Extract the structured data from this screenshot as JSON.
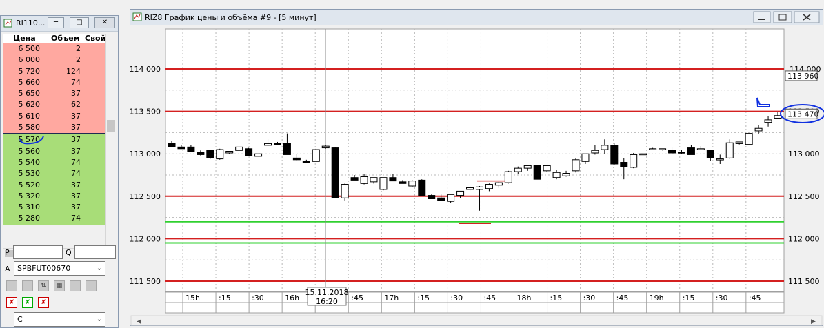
{
  "orderbook": {
    "title": "RI110...",
    "headers": {
      "price": "Цена",
      "volume": "Объем",
      "own": "Свой"
    },
    "asks": [
      {
        "price": "6 500",
        "volume": "2"
      },
      {
        "price": "6 000",
        "volume": "2"
      },
      {
        "price": "5 720",
        "volume": "124"
      },
      {
        "price": "5 660",
        "volume": "74"
      },
      {
        "price": "5 650",
        "volume": "37"
      },
      {
        "price": "5 620",
        "volume": "62"
      },
      {
        "price": "5 610",
        "volume": "37"
      },
      {
        "price": "5 580",
        "volume": "37"
      }
    ],
    "bids": [
      {
        "price": "5 570",
        "volume": "37"
      },
      {
        "price": "5 560",
        "volume": "37"
      },
      {
        "price": "5 540",
        "volume": "74"
      },
      {
        "price": "5 530",
        "volume": "74"
      },
      {
        "price": "5 520",
        "volume": "37"
      },
      {
        "price": "5 320",
        "volume": "37"
      },
      {
        "price": "5 310",
        "volume": "37"
      },
      {
        "price": "5 280",
        "volume": "74"
      }
    ],
    "p_label": "P",
    "q_label": "Q",
    "a_label": "A",
    "account": "SPBFUT00670",
    "bottom_combo": "C",
    "colors": {
      "ask": "#ffa8a0",
      "bid": "#a8dd78",
      "separator": "#1e2a50"
    }
  },
  "chart_window": {
    "title": "RIZ8 График цены и объёма #9 - [5 минут]"
  },
  "chart_data": {
    "type": "candlestick",
    "y_ticks": [
      "114 000",
      "113 500",
      "113 000",
      "112 500",
      "112 000",
      "111 500"
    ],
    "ylim": [
      111400,
      114400
    ],
    "x_tick_labels": [
      "15h",
      ":15",
      ":30",
      "16h",
      ":30",
      ":45",
      "17h",
      ":15",
      ":30",
      ":45",
      "18h",
      ":15",
      ":30",
      ":45",
      "19h",
      ":15",
      ":30",
      ":45"
    ],
    "cursor_label_date": "15.11.2018",
    "cursor_label_time": "16:20",
    "price_label_top": "113 960",
    "price_label_current": "113 470",
    "right_cut_labels": [
      "114 000"
    ],
    "levels": [
      {
        "price": 114000,
        "color": "#d42020"
      },
      {
        "price": 113500,
        "color": "#d42020"
      },
      {
        "price": 112500,
        "color": "#d42020"
      },
      {
        "price": 112000,
        "color": "#d42020"
      },
      {
        "price": 111500,
        "color": "#d42020"
      },
      {
        "price": 112200,
        "color": "#30d030"
      },
      {
        "price": 111950,
        "color": "#30d030"
      }
    ],
    "candles": [
      [
        113120,
        113150,
        113080,
        113080
      ],
      [
        113080,
        113100,
        113060,
        113060
      ],
      [
        113080,
        113100,
        113020,
        113030
      ],
      [
        113020,
        113040,
        112980,
        112990
      ],
      [
        113040,
        113050,
        112940,
        112950
      ],
      [
        112940,
        113060,
        112930,
        113050
      ],
      [
        113010,
        113030,
        113000,
        113030
      ],
      [
        113040,
        113080,
        113040,
        113080
      ],
      [
        113060,
        113070,
        112980,
        112980
      ],
      [
        112970,
        113000,
        112970,
        113000
      ],
      [
        113100,
        113180,
        113090,
        113120
      ],
      [
        113120,
        113140,
        113100,
        113110
      ],
      [
        113120,
        113240,
        112990,
        112990
      ],
      [
        112950,
        113000,
        112920,
        112930
      ],
      [
        112910,
        112930,
        112900,
        112900
      ],
      [
        112910,
        113060,
        112910,
        113050
      ],
      [
        113070,
        113100,
        113060,
        113090
      ],
      [
        113070,
        113080,
        112520,
        112480
      ],
      [
        112480,
        112650,
        112450,
        112640
      ],
      [
        112720,
        112750,
        112690,
        112690
      ],
      [
        112650,
        112760,
        112640,
        112730
      ],
      [
        112670,
        112720,
        112650,
        112720
      ],
      [
        112580,
        112720,
        112570,
        112720
      ],
      [
        112720,
        112760,
        112680,
        112680
      ],
      [
        112670,
        112690,
        112650,
        112650
      ],
      [
        112620,
        112690,
        112610,
        112680
      ],
      [
        112690,
        112700,
        112510,
        112510
      ],
      [
        112510,
        112520,
        112470,
        112470
      ],
      [
        112480,
        112520,
        112460,
        112450
      ],
      [
        112440,
        112520,
        112420,
        112520
      ],
      [
        112510,
        112560,
        112480,
        112560
      ],
      [
        112580,
        112620,
        112560,
        112600
      ],
      [
        112580,
        112620,
        112330,
        112610
      ],
      [
        112590,
        112650,
        112560,
        112640
      ],
      [
        112630,
        112670,
        112600,
        112660
      ],
      [
        112660,
        112800,
        112650,
        112790
      ],
      [
        112790,
        112850,
        112760,
        112830
      ],
      [
        112830,
        112860,
        112800,
        112860
      ],
      [
        112860,
        112870,
        112700,
        112700
      ],
      [
        112800,
        112870,
        112790,
        112860
      ],
      [
        112720,
        112810,
        112700,
        112780
      ],
      [
        112740,
        112800,
        112730,
        112770
      ],
      [
        112800,
        112950,
        112780,
        112930
      ],
      [
        112910,
        113000,
        112880,
        113000
      ],
      [
        113010,
        113100,
        112990,
        113040
      ],
      [
        113050,
        113170,
        113000,
        113100
      ],
      [
        113100,
        113130,
        112870,
        112880
      ],
      [
        112900,
        112950,
        112700,
        112850
      ],
      [
        112840,
        113010,
        112830,
        112990
      ],
      [
        112990,
        113000,
        112990,
        113000
      ],
      [
        113060,
        113070,
        113050,
        113060
      ],
      [
        113050,
        113060,
        113040,
        113060
      ],
      [
        113040,
        113080,
        113000,
        113010
      ],
      [
        113020,
        113050,
        113000,
        113010
      ],
      [
        113070,
        113100,
        112990,
        112990
      ],
      [
        113060,
        113090,
        113060,
        113060
      ],
      [
        113040,
        113050,
        112920,
        112950
      ],
      [
        112940,
        112990,
        112880,
        112940
      ],
      [
        112950,
        113170,
        112940,
        113130
      ],
      [
        113120,
        113140,
        113110,
        113140
      ],
      [
        113110,
        113150,
        113100,
        113240
      ],
      [
        113270,
        113340,
        113230,
        113300
      ],
      [
        113370,
        113440,
        113320,
        113400
      ],
      [
        113420,
        113490,
        113420,
        113450
      ]
    ]
  }
}
